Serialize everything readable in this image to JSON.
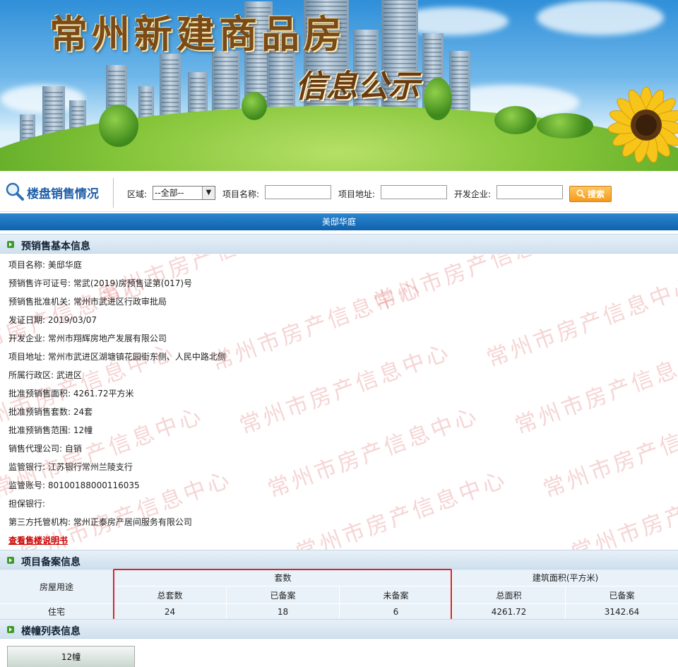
{
  "banner": {
    "title": "常州新建商品房",
    "subtitle": "信息公示"
  },
  "search": {
    "section_title": "楼盘销售情况",
    "region_label": "区域:",
    "region_value": "--全部--",
    "project_name_label": "项目名称:",
    "project_name_value": "",
    "project_address_label": "项目地址:",
    "project_address_value": "",
    "developer_label": "开发企业:",
    "developer_value": "",
    "button_label": "搜索"
  },
  "project_bar": {
    "name": "美邸华庭"
  },
  "basic_info": {
    "header": "预销售基本信息",
    "rows": [
      "项目名称: 美邸华庭",
      "预销售许可证号: 常武(2019)房预售证第(017)号",
      "预销售批准机关: 常州市武进区行政审批局",
      "发证日期: 2019/03/07",
      "开发企业: 常州市翔辉房地产发展有限公司",
      "项目地址: 常州市武进区湖塘镇花园街东侧、人民中路北侧",
      "所属行政区: 武进区",
      "批准预销售面积: 4261.72平方米",
      "批准预销售套数: 24套",
      "批准预销售范围: 12幢",
      "销售代理公司: 自销",
      "监管银行: 江苏银行常州兰陵支行",
      "监管账号: 80100188000116035",
      "担保银行:",
      "第三方托管机构: 常州正泰房产居间服务有限公司"
    ],
    "link": "查看售楼说明书",
    "watermark": "常州市房产信息中心"
  },
  "records": {
    "header": "项目备案信息",
    "col_usage": "房屋用途",
    "group_units": "套数",
    "group_area": "建筑面积(平方米)",
    "col_total_units": "总套数",
    "col_filed_units": "已备案",
    "col_unfiled_units": "未备案",
    "col_total_area": "总面积",
    "col_filed_area": "已备案",
    "row": {
      "usage": "住宅",
      "total_units": "24",
      "filed_units": "18",
      "unfiled_units": "6",
      "total_area": "4261.72",
      "filed_area": "3142.64"
    }
  },
  "building_list": {
    "header": "楼幢列表信息",
    "items": [
      "12幢"
    ]
  }
}
